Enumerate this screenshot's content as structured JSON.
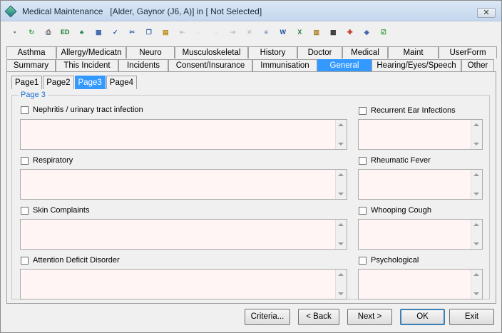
{
  "window": {
    "title": "Medical Maintenance",
    "context": "[Alder, Gaynor (J6, A)] in [ Not Selected]",
    "close_label": "✕"
  },
  "toolbar": {
    "items": [
      {
        "name": "save-icon",
        "glyph": "▪",
        "color": "#5a6b7c",
        "dim": false
      },
      {
        "name": "refresh-icon",
        "glyph": "↻",
        "color": "#2e9d3a",
        "dim": false
      },
      {
        "name": "print-icon",
        "glyph": "⎙",
        "color": "#555555",
        "dim": false
      },
      {
        "name": "edit-icon",
        "glyph": "ED",
        "color": "#1f7a2f",
        "dim": false
      },
      {
        "name": "tree-icon",
        "glyph": "♣",
        "color": "#2e8b57",
        "dim": false
      },
      {
        "name": "calculator-icon",
        "glyph": "▦",
        "color": "#3a5fa8",
        "dim": false
      },
      {
        "name": "spellcheck-icon",
        "glyph": "✓",
        "color": "#2255aa",
        "dim": false
      },
      {
        "name": "cut-icon",
        "glyph": "✂",
        "color": "#2f5fb3",
        "dim": false
      },
      {
        "name": "copy-icon",
        "glyph": "❐",
        "color": "#3a6ea5",
        "dim": false
      },
      {
        "name": "paste-icon",
        "glyph": "▤",
        "color": "#b8860b",
        "dim": false
      },
      {
        "name": "first-record-icon",
        "glyph": "⇤",
        "color": "#888888",
        "dim": true
      },
      {
        "name": "previous-record-icon",
        "glyph": "←",
        "color": "#888888",
        "dim": true
      },
      {
        "name": "next-record-icon",
        "glyph": "→",
        "color": "#888888",
        "dim": true
      },
      {
        "name": "last-record-icon",
        "glyph": "⇥",
        "color": "#888888",
        "dim": true
      },
      {
        "name": "delete-icon",
        "glyph": "✕",
        "color": "#888888",
        "dim": true
      },
      {
        "name": "form-icon",
        "glyph": "≡",
        "color": "#3a5fa8",
        "dim": false
      },
      {
        "name": "word-icon",
        "glyph": "W",
        "color": "#1e4fa3",
        "dim": false
      },
      {
        "name": "excel-icon",
        "glyph": "X",
        "color": "#1d7a3a",
        "dim": false
      },
      {
        "name": "clipboard-icon",
        "glyph": "▥",
        "color": "#a87a1a",
        "dim": false
      },
      {
        "name": "film-icon",
        "glyph": "▩",
        "color": "#333333",
        "dim": false
      },
      {
        "name": "ambulance-icon",
        "glyph": "✚",
        "color": "#c0392b",
        "dim": false
      },
      {
        "name": "tag-icon",
        "glyph": "◈",
        "color": "#3a5fa8",
        "dim": false
      },
      {
        "name": "checklist-icon",
        "glyph": "☑",
        "color": "#2e9d3a",
        "dim": false
      }
    ]
  },
  "tabs": {
    "row1": [
      {
        "label": "Asthma",
        "w": 70
      },
      {
        "label": "Allergy/Medicatn",
        "w": 98
      },
      {
        "label": "Neuro",
        "w": 68
      },
      {
        "label": "Musculoskeletal",
        "w": 103
      },
      {
        "label": "History",
        "w": 69
      },
      {
        "label": "Doctor",
        "w": 63
      },
      {
        "label": "Medical",
        "w": 64
      },
      {
        "label": "Maint",
        "w": 71
      },
      {
        "label": "UserForm",
        "w": 82
      }
    ],
    "row2": [
      {
        "label": "Summary",
        "w": 69,
        "active": false
      },
      {
        "label": "This Incident",
        "w": 88,
        "active": false
      },
      {
        "label": "Incidents",
        "w": 70,
        "active": false
      },
      {
        "label": "Consent/Insurance",
        "w": 118,
        "active": false
      },
      {
        "label": "Immunisation",
        "w": 91,
        "active": false
      },
      {
        "label": "General",
        "w": 76,
        "active": true
      },
      {
        "label": "Hearing/Eyes/Speech",
        "w": 126,
        "active": false
      },
      {
        "label": "Other",
        "w": 46,
        "active": false
      }
    ]
  },
  "subtabs": [
    {
      "label": "Page1",
      "active": false
    },
    {
      "label": "Page2",
      "active": false
    },
    {
      "label": "Page3",
      "active": true
    },
    {
      "label": "Page4",
      "active": false
    }
  ],
  "group": {
    "label": "Page 3"
  },
  "fields": {
    "left": [
      {
        "label": "Nephritis / urinary tract infection",
        "checked": false,
        "value": ""
      },
      {
        "label": "Respiratory",
        "checked": false,
        "value": ""
      },
      {
        "label": "Skin Complaints",
        "checked": false,
        "value": ""
      },
      {
        "label": "Attention Deficit Disorder",
        "checked": false,
        "value": ""
      }
    ],
    "right": [
      {
        "label": "Recurrent Ear Infections",
        "checked": false,
        "value": ""
      },
      {
        "label": "Rheumatic Fever",
        "checked": false,
        "value": ""
      },
      {
        "label": "Whooping Cough",
        "checked": false,
        "value": ""
      },
      {
        "label": "Psychological",
        "checked": false,
        "value": ""
      }
    ]
  },
  "buttons": {
    "criteria": "Criteria...",
    "back": "< Back",
    "next": "Next >",
    "ok": "OK",
    "exit": "Exit"
  }
}
